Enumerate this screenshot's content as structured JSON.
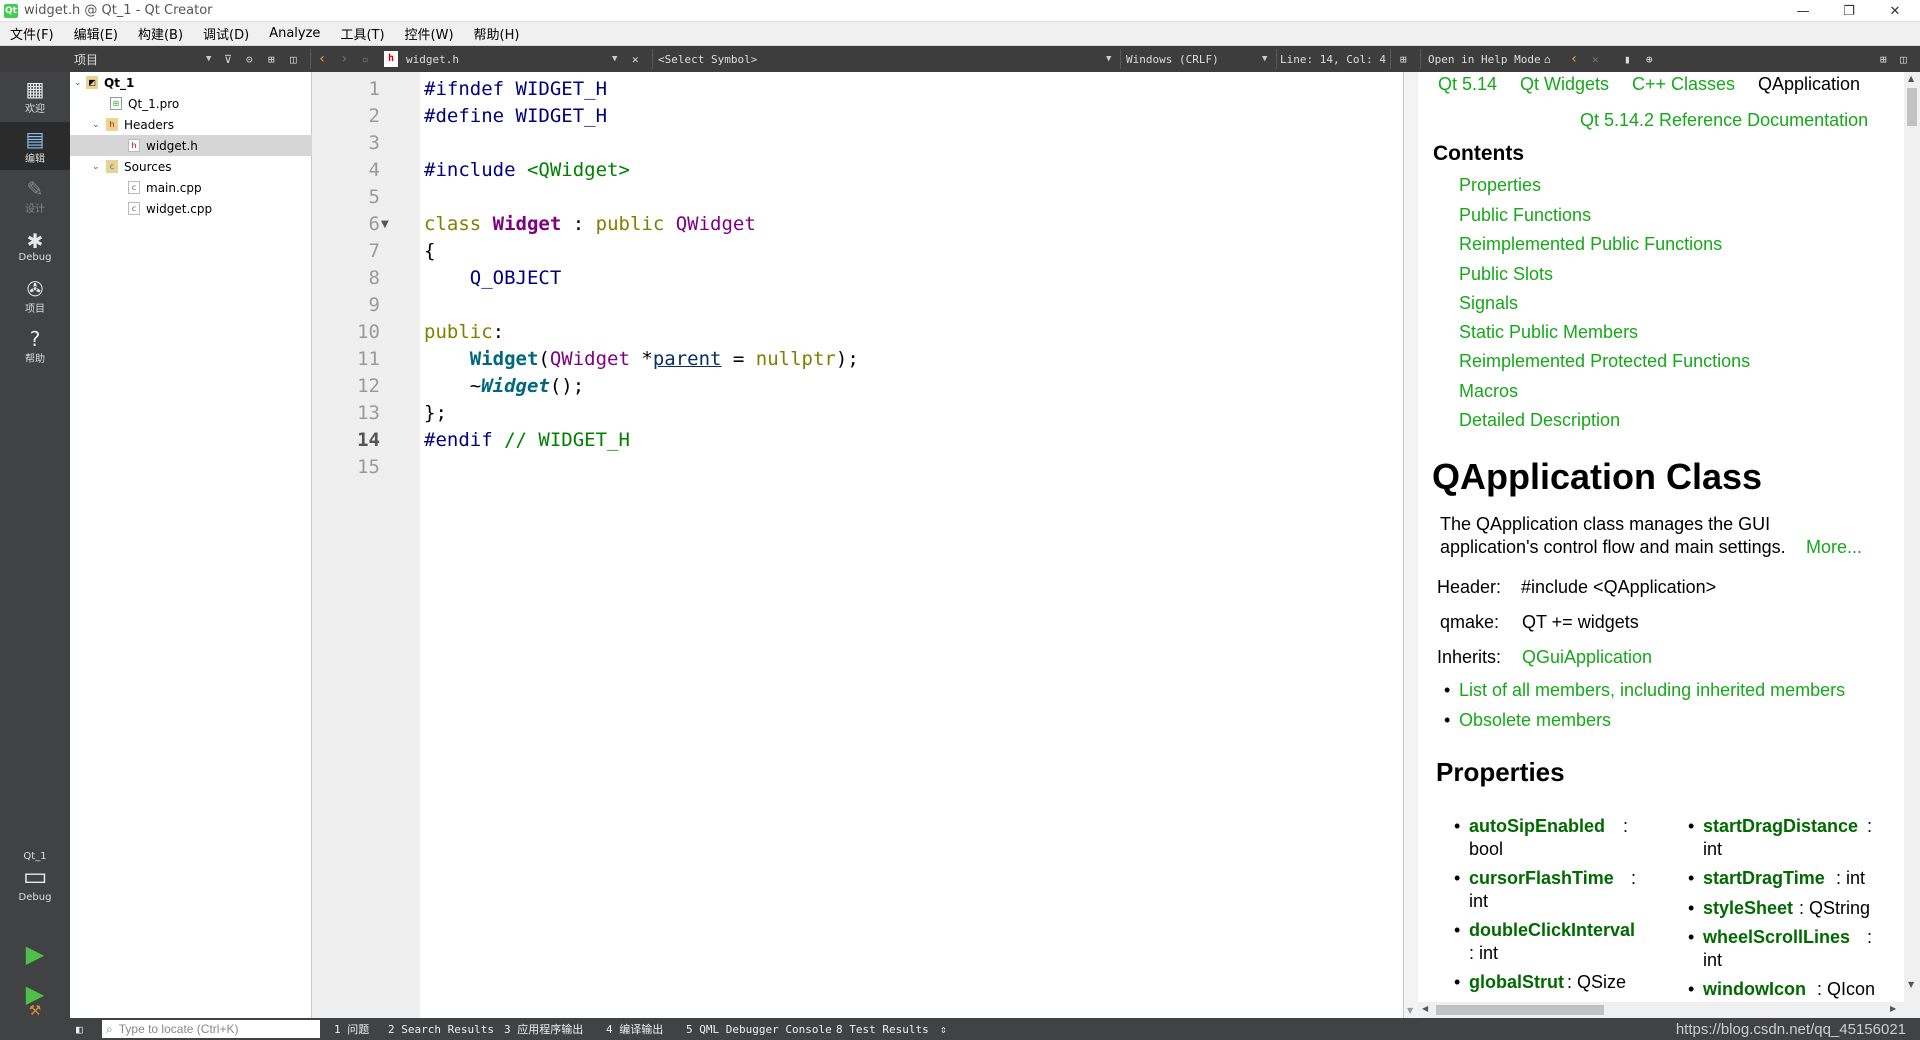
{
  "window": {
    "title": "widget.h @ Qt_1 - Qt Creator",
    "logo": "Qt"
  },
  "window_controls": [
    "—",
    "❐",
    "✕"
  ],
  "menu": [
    "文件(F)",
    "编辑(E)",
    "构建(B)",
    "调试(D)",
    "Analyze",
    "工具(T)",
    "控件(W)",
    "帮助(H)"
  ],
  "toolbar": {
    "project_label": "项目",
    "file_name": "widget.h",
    "symbol_placeholder": "<Select Symbol>",
    "line_ending": "Windows (CRLF)",
    "cursor_pos": "Line: 14, Col: 4",
    "help_mode": "Open in Help Mode"
  },
  "modes": [
    {
      "label": "欢迎",
      "icon": "grid-icon"
    },
    {
      "label": "编辑",
      "icon": "edit-icon"
    },
    {
      "label": "设计",
      "icon": "pencil-icon"
    },
    {
      "label": "Debug",
      "icon": "bug-icon"
    },
    {
      "label": "项目",
      "icon": "wrench-icon"
    },
    {
      "label": "帮助",
      "icon": "help-icon"
    }
  ],
  "kit": {
    "project": "Qt_1",
    "config": "Debug"
  },
  "tree": {
    "root": "Qt_1",
    "pro": "Qt_1.pro",
    "headers": "Headers",
    "header_file": "widget.h",
    "sources": "Sources",
    "source_files": [
      "main.cpp",
      "widget.cpp"
    ]
  },
  "code": {
    "line_numbers": [
      "1",
      "2",
      "3",
      "4",
      "5",
      "6",
      "7",
      "8",
      "9",
      "10",
      "11",
      "12",
      "13",
      "14",
      "15"
    ],
    "current_line": "14"
  },
  "help": {
    "breadcrumbs": [
      "Qt 5.14",
      "Qt Widgets",
      "C++ Classes",
      "QApplication"
    ],
    "ref_doc": "Qt 5.14.2 Reference Documentation",
    "contents_title": "Contents",
    "contents": [
      "Properties",
      "Public Functions",
      "Reimplemented Public Functions",
      "Public Slots",
      "Signals",
      "Static Public Members",
      "Reimplemented Protected Functions",
      "Macros",
      "Detailed Description"
    ],
    "class_title": "QApplication Class",
    "desc1": "The QApplication class manages the GUI",
    "desc2": "application's control flow and main settings.",
    "more": "More...",
    "header_label": "Header:",
    "header_value": "#include <QApplication>",
    "qmake_label": "qmake:",
    "qmake_value": "QT += widgets",
    "inherits_label": "Inherits:",
    "inherits_value": "QGuiApplication",
    "list_all": "List of all members, including inherited members",
    "obsolete": "Obsolete members",
    "properties_title": "Properties",
    "props_left": [
      {
        "name": "autoSipEnabled",
        "sep": " :",
        "type": "bool"
      },
      {
        "name": "cursorFlashTime",
        "sep": " :",
        "type": "int"
      },
      {
        "name": "doubleClickInterval",
        "sep": "",
        "type": ": int"
      },
      {
        "name": "globalStrut",
        "sep": " : QSize",
        "type": ""
      }
    ],
    "props_right": [
      {
        "name": "startDragDistance",
        "sep": " :",
        "type": "int"
      },
      {
        "name": "startDragTime",
        "sep": " : int",
        "type": ""
      },
      {
        "name": "styleSheet",
        "sep": " : QString",
        "type": ""
      },
      {
        "name": "wheelScrollLines",
        "sep": " :",
        "type": "int"
      },
      {
        "name": "windowIcon",
        "sep": " : QIcon",
        "type": ""
      }
    ]
  },
  "status": {
    "locator_placeholder": "Type to locate (Ctrl+K)",
    "tabs": [
      "1  问题",
      "2  Search Results",
      "3  应用程序输出",
      "4  编译输出",
      "5  QML Debugger Console",
      "8  Test Results"
    ],
    "watermark": "https://blog.csdn.net/qq_45156021"
  }
}
